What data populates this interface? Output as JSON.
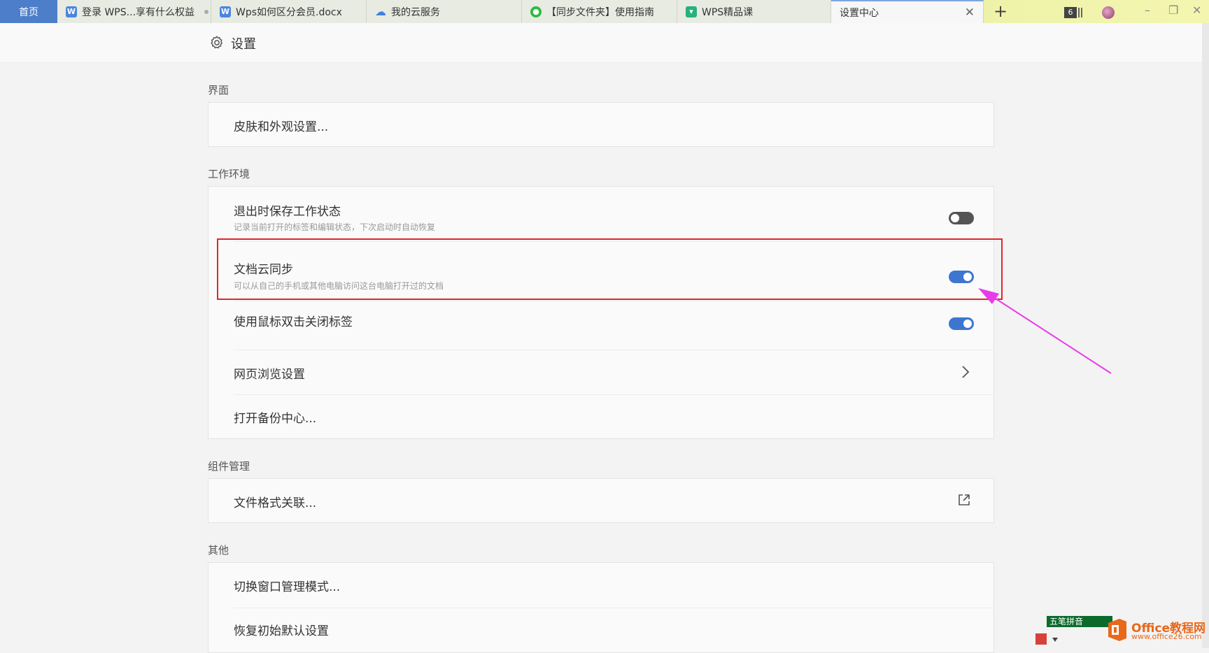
{
  "tabs": {
    "home": "首页",
    "items": [
      {
        "label": "登录 WPS...享有什么权益",
        "icon": "wps-writer-icon"
      },
      {
        "label": "Wps如何区分会员.docx",
        "icon": "wps-writer-icon"
      },
      {
        "label": "我的云服务",
        "icon": "cloud-icon"
      },
      {
        "label": "【同步文件夹】使用指南",
        "icon": "wechat-icon"
      },
      {
        "label": "WPS精品课",
        "icon": "course-icon"
      },
      {
        "label": "设置中心",
        "icon": ""
      }
    ],
    "count": "6"
  },
  "header": {
    "title": "设置"
  },
  "sections": {
    "interface": {
      "title": "界面",
      "rows": {
        "skin": "皮肤和外观设置..."
      }
    },
    "workenv": {
      "title": "工作环境",
      "rows": {
        "save_state": {
          "label": "退出时保存工作状态",
          "desc": "记录当前打开的标签和编辑状态，下次启动时自动恢复",
          "enabled": false
        },
        "cloud_sync": {
          "label": "文档云同步",
          "desc": "可以从自己的手机或其他电脑访问这台电脑打开过的文档",
          "enabled": true
        },
        "dblclick_close": {
          "label": "使用鼠标双击关闭标签",
          "enabled": true
        },
        "web_browse": "网页浏览设置",
        "backup": "打开备份中心..."
      }
    },
    "components": {
      "title": "组件管理",
      "rows": {
        "file_assoc": "文件格式关联..."
      }
    },
    "other": {
      "title": "其他",
      "rows": {
        "window_mode": "切换窗口管理模式...",
        "restore": "恢复初始默认设置"
      }
    }
  },
  "colors": {
    "accent": "#3d76d1",
    "highlight": "#e4242c",
    "arrow": "#e83ce8"
  },
  "watermark": {
    "ime": "五笔拼音",
    "brand": "Office教程网",
    "url": "www.office26.com"
  }
}
